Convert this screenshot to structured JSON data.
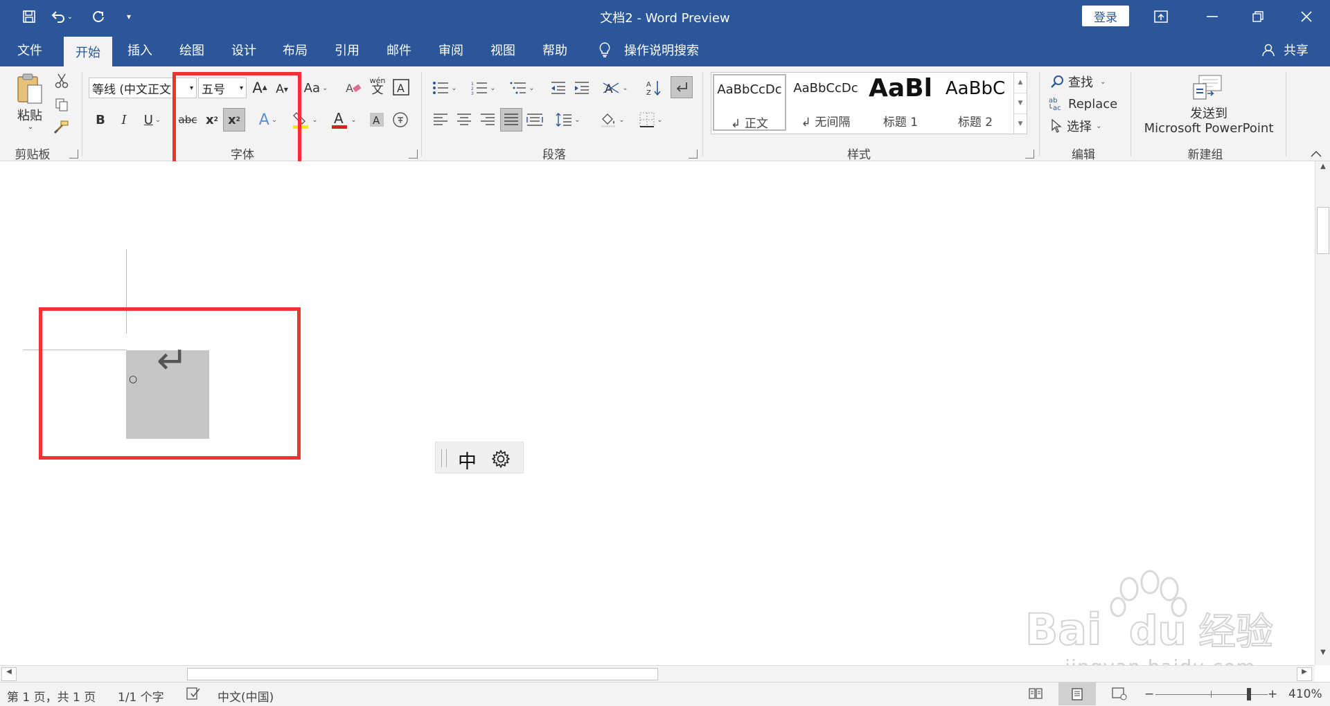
{
  "window": {
    "title": "文档2 - Word Preview",
    "login_label": "登录",
    "share_label": "共享",
    "quick_access": [
      "save-icon",
      "undo-icon",
      "redo-icon",
      "customize-icon"
    ]
  },
  "tabs": [
    {
      "label": "文件"
    },
    {
      "label": "开始",
      "active": true
    },
    {
      "label": "插入"
    },
    {
      "label": "绘图"
    },
    {
      "label": "设计"
    },
    {
      "label": "布局"
    },
    {
      "label": "引用"
    },
    {
      "label": "邮件"
    },
    {
      "label": "审阅"
    },
    {
      "label": "视图"
    },
    {
      "label": "帮助"
    }
  ],
  "tell_me": "操作说明搜索",
  "ribbon": {
    "clipboard": {
      "paste_label": "粘贴",
      "group_label": "剪贴板"
    },
    "font": {
      "font_name": "等线 (中文正文",
      "font_size": "五号",
      "change_case_label": "Aa",
      "phonetic_top": "wén",
      "phonetic_bottom": "文",
      "group_label": "字体"
    },
    "paragraph": {
      "group_label": "段落"
    },
    "styles": {
      "group_label": "样式",
      "items": [
        {
          "preview": "AaBbCcDc",
          "name": "↲ 正文"
        },
        {
          "preview": "AaBbCcDc",
          "name": "↲ 无间隔"
        },
        {
          "preview": "AaBl",
          "name": "标题 1"
        },
        {
          "preview": "AaBbC",
          "name": "标题 2"
        }
      ]
    },
    "editing": {
      "find_label": "查找",
      "replace_label": "Replace",
      "select_label": "选择",
      "group_label": "编辑"
    },
    "new_group": {
      "line1": "发送到",
      "line2": "Microsoft PowerPoint",
      "group_label": "新建组"
    }
  },
  "document": {
    "return_mark": "↵",
    "degree_mark": "○",
    "ime_char": "中"
  },
  "watermark": {
    "logo": "Bai du 经验",
    "url": "jingyan.baidu.com"
  },
  "statusbar": {
    "page": "第 1 页，共 1 页",
    "words": "1/1 个字",
    "language": "中文(中国)",
    "zoom": "410%"
  }
}
